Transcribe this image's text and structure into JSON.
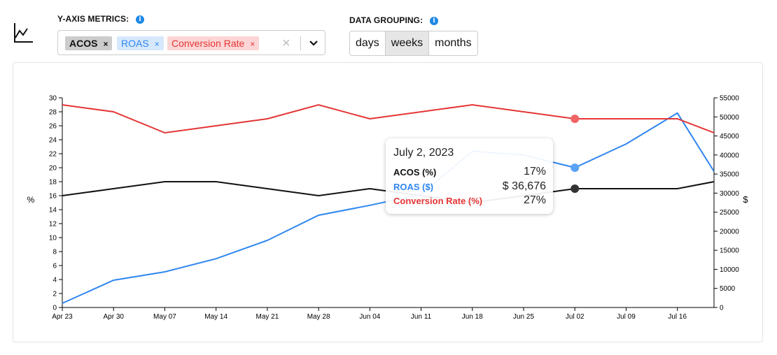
{
  "controls": {
    "metrics_label": "Y-AXIS METRICS:",
    "metrics_chips": [
      {
        "label": "ACOS",
        "remove": "×",
        "bg": "#cccccc",
        "fg": "#111111"
      },
      {
        "label": "ROAS",
        "remove": "×",
        "bg": "#d6e8fc",
        "fg": "#2f86f0"
      },
      {
        "label": "Conversion Rate",
        "remove": "×",
        "bg": "#fcd6d6",
        "fg": "#e53535"
      }
    ],
    "clear_icon": "×",
    "grouping_label": "DATA GROUPING:",
    "grouping_options": [
      "days",
      "weeks",
      "months"
    ],
    "grouping_selected": "weeks",
    "info_icon": "i"
  },
  "tooltip": {
    "date": "July 2, 2023",
    "rows": [
      {
        "label": "ACOS (%)",
        "value": "17%",
        "color": "#111111"
      },
      {
        "label": "ROAS ($)",
        "value": "$ 36,676",
        "color": "#2f86f0"
      },
      {
        "label": "Conversion Rate (%)",
        "value": "27%",
        "color": "#e53535"
      }
    ]
  },
  "chart_data": {
    "type": "line",
    "x": [
      "2023-04-23",
      "2023-04-30",
      "2023-05-07",
      "2023-05-14",
      "2023-05-21",
      "2023-05-28",
      "2023-06-04",
      "2023-06-11",
      "2023-06-18",
      "2023-06-25",
      "2023-07-02",
      "2023-07-09",
      "2023-07-16",
      "2023-07-21"
    ],
    "x_tick_labels": [
      "Apr 23",
      "Apr 30",
      "May 07",
      "May 14",
      "May 21",
      "May 28",
      "Jun 04",
      "Jun 11",
      "Jun 18",
      "Jun 25",
      "Jul 02",
      "Jul 09",
      "Jul 16"
    ],
    "xlim": [
      "2023-04-23",
      "2023-07-21"
    ],
    "ylabel_left": "%",
    "ylabel_right": "$",
    "ylim_left": [
      0,
      30
    ],
    "ylim_right": [
      0,
      55000
    ],
    "yticks_left": [
      0,
      2,
      4,
      6,
      8,
      10,
      12,
      14,
      16,
      18,
      20,
      22,
      24,
      26,
      28,
      30
    ],
    "yticks_right": [
      0,
      5000,
      10000,
      15000,
      20000,
      25000,
      30000,
      35000,
      40000,
      45000,
      50000,
      55000
    ],
    "grid": false,
    "highlighted_x": "2023-07-02",
    "series": [
      {
        "key": "acos",
        "axis": "left",
        "color": "#111111",
        "marker": "#333333",
        "values": [
          16,
          17,
          18,
          18,
          17,
          16,
          17,
          16,
          15,
          16,
          17,
          17,
          17,
          18
        ]
      },
      {
        "key": "roas",
        "axis": "right",
        "color": "#2f86f0",
        "marker": "#5aa2f5",
        "values": [
          1100,
          7150,
          9350,
          12800,
          17600,
          24200,
          26800,
          29700,
          41000,
          40000,
          36676,
          42900,
          51000,
          35700
        ]
      },
      {
        "key": "conversion",
        "axis": "left",
        "color": "#e53535",
        "marker": "#f06464",
        "values": [
          29,
          28,
          25,
          26,
          27,
          29,
          27,
          28,
          29,
          28,
          27,
          27,
          27,
          25
        ]
      }
    ]
  }
}
